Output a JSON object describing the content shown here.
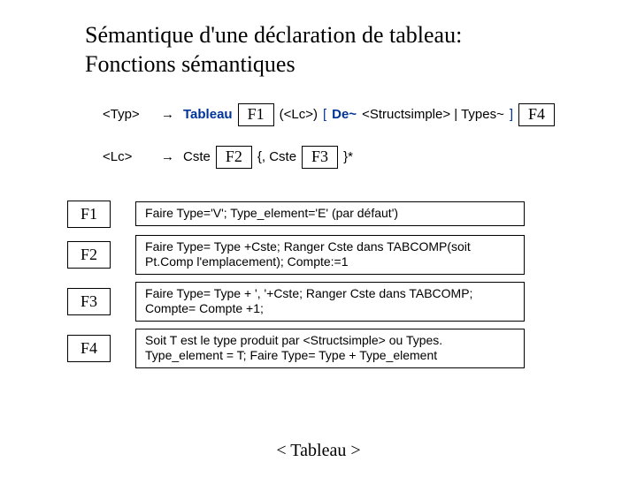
{
  "title_line1": "Sémantique d'une déclaration de tableau:",
  "title_line2": "Fonctions sémantiques",
  "rule1": {
    "lhs": "<Typ>",
    "arrow": "→",
    "kw": "Tableau",
    "f1": "F1",
    "mid1": "(<Lc>)",
    "mid2": "[",
    "mid3": "De~",
    "mid4": "<Structsimple> | Types~",
    "mid5": "]",
    "f4": "F4"
  },
  "rule2": {
    "lhs": "<Lc>",
    "arrow": "→",
    "kw": "Cste",
    "f2": "F2",
    "mid1": "{, Cste",
    "f3": "F3",
    "mid2": "}*"
  },
  "defs": [
    {
      "label": "F1",
      "text": "Faire Type='V'; Type_element='E' (par défaut')"
    },
    {
      "label": "F2",
      "text": "Faire Type= Type +Cste; Ranger Cste dans TABCOMP(soit Pt.Comp l'emplacement); Compte:=1"
    },
    {
      "label": "F3",
      "text": "Faire Type= Type + ', '+Cste; Ranger Cste dans TABCOMP; Compte= Compte +1;"
    },
    {
      "label": "F4",
      "text": "Soit T est le type produit par <Structsimple>  ou Types. Type_element = T; Faire Type= Type + Type_element"
    }
  ],
  "footer": "< Tableau >"
}
